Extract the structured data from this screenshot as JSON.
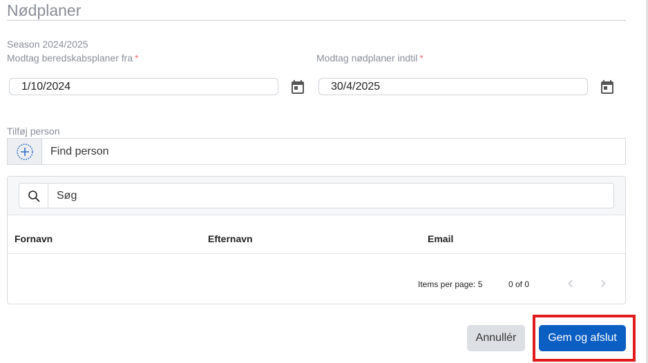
{
  "page": {
    "title": "Nødplaner",
    "season": "Season 2024/2025"
  },
  "dates": {
    "from_label": "Modtag beredskabsplaner fra",
    "from_value": "1/10/2024",
    "to_label": "Modtag nødplaner indtil",
    "to_value": "30/4/2025",
    "required_mark": "*"
  },
  "add_person": {
    "label": "Tilføj person",
    "input_value": "Find person"
  },
  "table": {
    "search_value": "Søg",
    "columns": [
      "Fornavn",
      "Efternavn",
      "Email"
    ],
    "rows": []
  },
  "pager": {
    "items_per_page": "Items per page: 5",
    "range": "0 of 0"
  },
  "actions": {
    "cancel_label": "Annullér",
    "save_label": "Gem og afslut"
  },
  "colors": {
    "primary": "#0b5ec2",
    "highlight": "#e11b1b",
    "required": "#e57373"
  },
  "icons": {
    "calendar": "calendar-icon",
    "add": "plus-circle-icon",
    "search": "search-icon",
    "prev": "chevron-left-icon",
    "next": "chevron-right-icon"
  }
}
